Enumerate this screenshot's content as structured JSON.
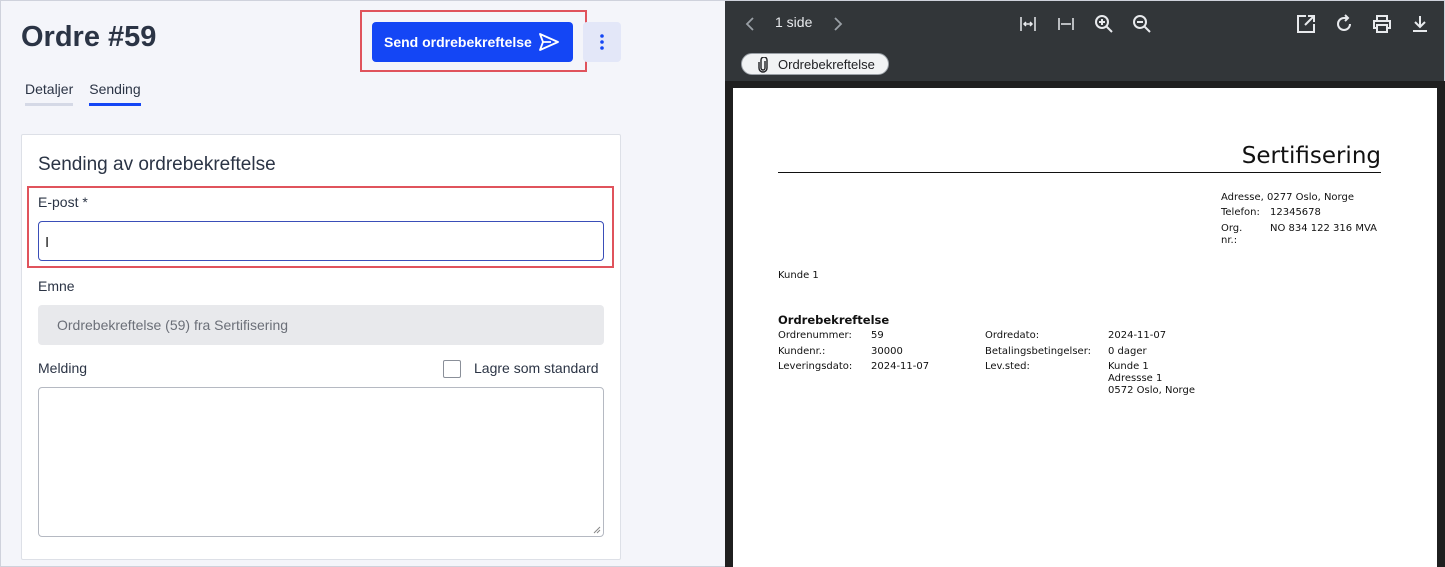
{
  "header": {
    "title": "Ordre #59",
    "send_label": "Send ordrebekreftelse",
    "more_icon": "kebab-vertical-icon"
  },
  "tabs": [
    {
      "label": "Detaljer",
      "active": false
    },
    {
      "label": "Sending",
      "active": true
    }
  ],
  "form": {
    "card_title": "Sending av ordrebekreftelse",
    "email_label": "E-post *",
    "email_value": "",
    "subject_label": "Emne",
    "subject_value": "Ordrebekreftelse (59) fra Sertifisering",
    "message_label": "Melding",
    "save_default_label": "Lagre som standard",
    "save_default_checked": false,
    "message_value": ""
  },
  "viewer": {
    "page_count": "1 side",
    "attachment_label": "Ordrebekreftelse"
  },
  "pdf": {
    "company": "Sertifisering",
    "address": "Adresse, 0277 Oslo, Norge",
    "phone_label": "Telefon:",
    "phone": "12345678",
    "org_label": "Org. nr.:",
    "org": "NO 834 122 316 MVA",
    "customer": "Kunde 1",
    "doc_title": "Ordrebekreftelse",
    "fields_left": [
      {
        "label": "Ordrenummer:",
        "value": "59"
      },
      {
        "label": "Kundenr.:",
        "value": "30000"
      },
      {
        "label": "Leveringsdato:",
        "value": "2024-11-07"
      }
    ],
    "fields_right": [
      {
        "label": "Ordredato:",
        "value": "2024-11-07"
      },
      {
        "label": "Betalingsbetingelser:",
        "value": "0 dager"
      },
      {
        "label": "Lev.sted:",
        "value": "Kunde 1"
      }
    ],
    "delivery_address": [
      "Adressse 1",
      "0572 Oslo, Norge"
    ]
  },
  "colors": {
    "primary": "#1446f5",
    "highlight": "#e0535c",
    "viewer_bg": "#323639"
  }
}
